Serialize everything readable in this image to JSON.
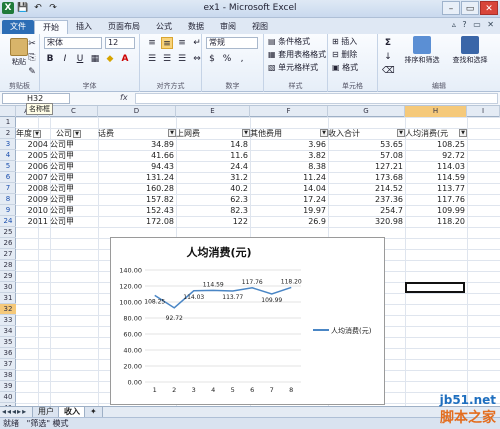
{
  "window": {
    "title": "ex1 - Microsoft Excel",
    "controls": [
      "–",
      "▭",
      "✕"
    ]
  },
  "ribbon": {
    "tabs": [
      "文件",
      "开始",
      "插入",
      "页面布局",
      "公式",
      "数据",
      "审阅",
      "视图"
    ],
    "clipboard": {
      "paste": "粘贴",
      "label": "剪贴板"
    },
    "font": {
      "name": "宋体",
      "size": "12",
      "label": "字体",
      "bold": "B",
      "italic": "I",
      "underline": "U",
      "grow": "A",
      "color_a": "A"
    },
    "alignment": {
      "label": "对齐方式"
    },
    "number": {
      "format": "常规",
      "label": "数字",
      "percent": "%",
      "comma": ",",
      "currency": "$"
    },
    "styles": {
      "cond_format": "条件格式",
      "table_format": "套用表格格式",
      "cell_styles": "单元格样式",
      "label": "样式"
    },
    "cells": {
      "insert": "插入",
      "delete": "删除",
      "format": "格式",
      "label": "单元格"
    },
    "editing": {
      "sort_filter": "排序和筛选",
      "find_select": "查找和选择",
      "label": "编辑",
      "sum": "Σ"
    }
  },
  "formula_bar": {
    "name_box": "H32",
    "tooltip": "名称框",
    "fx": "fx",
    "value": ""
  },
  "columns": [
    "A",
    "B",
    "C",
    "D",
    "E",
    "F",
    "G",
    "H",
    "I"
  ],
  "rows": [
    "1",
    "2",
    "3",
    "4",
    "5",
    "6",
    "7",
    "8",
    "9",
    "24",
    "25",
    "26",
    "27",
    "28",
    "29",
    "30",
    "31",
    "32",
    "33",
    "34",
    "35",
    "36",
    "37",
    "38",
    "39",
    "40",
    "41"
  ],
  "headers": [
    "年度",
    "公司",
    "话费",
    "上网费",
    "其他费用",
    "收入合计",
    "人均消费(元"
  ],
  "data": [
    [
      "2004",
      "公司甲",
      "34.89",
      "14.8",
      "3.96",
      "53.65",
      "108.25"
    ],
    [
      "2005",
      "公司甲",
      "41.66",
      "11.6",
      "3.82",
      "57.08",
      "92.72"
    ],
    [
      "2006",
      "公司甲",
      "94.43",
      "24.4",
      "8.38",
      "127.21",
      "114.03"
    ],
    [
      "2007",
      "公司甲",
      "131.24",
      "31.2",
      "11.24",
      "173.68",
      "114.59"
    ],
    [
      "2008",
      "公司甲",
      "160.28",
      "40.2",
      "14.04",
      "214.52",
      "113.77"
    ],
    [
      "2009",
      "公司甲",
      "157.82",
      "62.3",
      "17.24",
      "237.36",
      "117.76"
    ],
    [
      "2010",
      "公司甲",
      "152.43",
      "82.3",
      "19.97",
      "254.7",
      "109.99"
    ],
    [
      "2011",
      "公司甲",
      "172.08",
      "122",
      "26.9",
      "320.98",
      "118.20"
    ]
  ],
  "chart_data": {
    "type": "line",
    "title": "人均消费(元)",
    "x": [
      1,
      2,
      3,
      4,
      5,
      6,
      7,
      8
    ],
    "series": [
      {
        "name": "人均消费(元)",
        "values": [
          108.25,
          92.72,
          114.03,
          114.59,
          113.77,
          117.76,
          109.99,
          118.2
        ],
        "color": "#4a86c5"
      }
    ],
    "data_labels": [
      "108.25",
      "92.72",
      "114.03",
      "114.59",
      "113.77",
      "117.76",
      "109.99",
      "118.20"
    ],
    "yticks": [
      "0.00",
      "20.00",
      "40.00",
      "60.00",
      "80.00",
      "100.00",
      "120.00",
      "140.00"
    ],
    "ylim": [
      0,
      140
    ],
    "grid": true,
    "legend": "right"
  },
  "sheets": [
    "用户",
    "收入"
  ],
  "status": {
    "mode": "就绪",
    "filter": "\"筛选\" 模式"
  },
  "watermark": {
    "line1": "jb51.net",
    "line2": "脚本之家"
  }
}
